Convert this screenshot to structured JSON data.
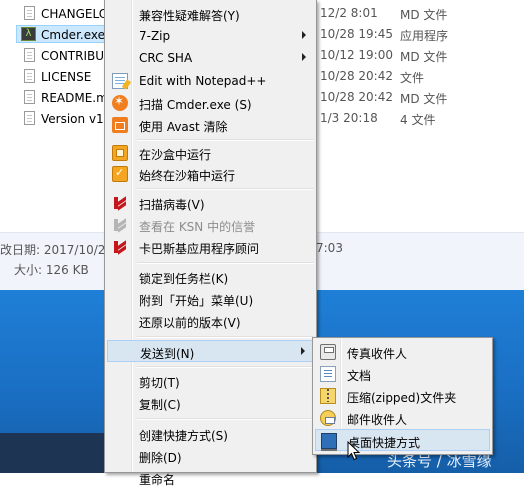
{
  "explorer": {
    "files": [
      {
        "name": "CHANGELOG",
        "date": "12/2 8:01",
        "type": "MD 文件",
        "icon": "document-icon",
        "selected": false
      },
      {
        "name": "Cmder.exe",
        "date": "10/28 19:45",
        "type": "应用程序",
        "icon": "cmder-icon",
        "selected": true
      },
      {
        "name": "CONTRIBU",
        "date": "10/12 19:00",
        "type": "MD 文件",
        "icon": "document-icon",
        "selected": false
      },
      {
        "name": "LICENSE",
        "date": "10/28 20:42",
        "type": "文件",
        "icon": "document-icon",
        "selected": false
      },
      {
        "name": "README.m",
        "date": "10/28 20:42",
        "type": "MD 文件",
        "icon": "document-icon",
        "selected": false
      },
      {
        "name": "Version v1.",
        "date": "1/3 20:18",
        "type": "4 文件",
        "icon": "document-icon",
        "selected": false
      }
    ],
    "details": {
      "date_label": "改日期: 2017/10/2",
      "date_tail": "7:03",
      "size_label": "大小: 126 KB"
    }
  },
  "context_menu": {
    "items": [
      {
        "label": "兼容性疑难解答(Y)",
        "icon": "",
        "arrow": false,
        "disabled": false
      },
      {
        "label": "7-Zip",
        "icon": "",
        "arrow": true,
        "disabled": false
      },
      {
        "label": "CRC SHA",
        "icon": "",
        "arrow": true,
        "disabled": false
      },
      {
        "label": "Edit with Notepad++",
        "icon": "notepad-plus-plus-icon",
        "arrow": false,
        "disabled": false
      },
      {
        "label": "扫描 Cmder.exe (S)",
        "icon": "avast-scan-icon",
        "arrow": false,
        "disabled": false
      },
      {
        "label": "使用 Avast 清除",
        "icon": "avast-clean-icon",
        "arrow": false,
        "disabled": false
      },
      {
        "label": "在沙盒中运行",
        "icon": "sandbox-icon",
        "arrow": false,
        "disabled": false
      },
      {
        "label": "始终在沙箱中运行",
        "icon": "sandbox-always-icon",
        "arrow": false,
        "disabled": false
      },
      {
        "label": "扫描病毒(V)",
        "icon": "kaspersky-icon",
        "arrow": false,
        "disabled": false
      },
      {
        "label": "查看在 KSN 中的信誉",
        "icon": "kaspersky-ksn-icon",
        "arrow": false,
        "disabled": true
      },
      {
        "label": "卡巴斯基应用程序顾问",
        "icon": "kaspersky-advisor-icon",
        "arrow": false,
        "disabled": false
      },
      {
        "label": "锁定到任务栏(K)",
        "icon": "",
        "arrow": false,
        "disabled": false
      },
      {
        "label": "附到「开始」菜单(U)",
        "icon": "",
        "arrow": false,
        "disabled": false
      },
      {
        "label": "还原以前的版本(V)",
        "icon": "",
        "arrow": false,
        "disabled": false
      },
      {
        "label": "发送到(N)",
        "icon": "",
        "arrow": true,
        "disabled": false,
        "highlighted": true
      },
      {
        "label": "剪切(T)",
        "icon": "",
        "arrow": false,
        "disabled": false
      },
      {
        "label": "复制(C)",
        "icon": "",
        "arrow": false,
        "disabled": false
      },
      {
        "label": "创建快捷方式(S)",
        "icon": "",
        "arrow": false,
        "disabled": false
      },
      {
        "label": "删除(D)",
        "icon": "",
        "arrow": false,
        "disabled": false
      },
      {
        "label": "重命名",
        "icon": "",
        "arrow": false,
        "disabled": false
      }
    ]
  },
  "send_to_submenu": {
    "items": [
      {
        "label": "传真收件人",
        "icon": "fax-icon"
      },
      {
        "label": "文档",
        "icon": "documents-icon"
      },
      {
        "label": "压缩(zipped)文件夹",
        "icon": "zip-folder-icon"
      },
      {
        "label": "邮件收件人",
        "icon": "mail-recipient-icon"
      },
      {
        "label": "桌面快捷方式",
        "icon": "desktop-shortcut-icon",
        "highlighted": true
      }
    ]
  },
  "watermark": "头条号 / 冰雪缘",
  "colors": {
    "menu_bg": "#f0f0f0",
    "highlight_bg": "#d8e6f2",
    "highlight_border": "#aecff7",
    "desktop_blue": "#1a6fc3",
    "details_bg": "#f1f5fb"
  }
}
